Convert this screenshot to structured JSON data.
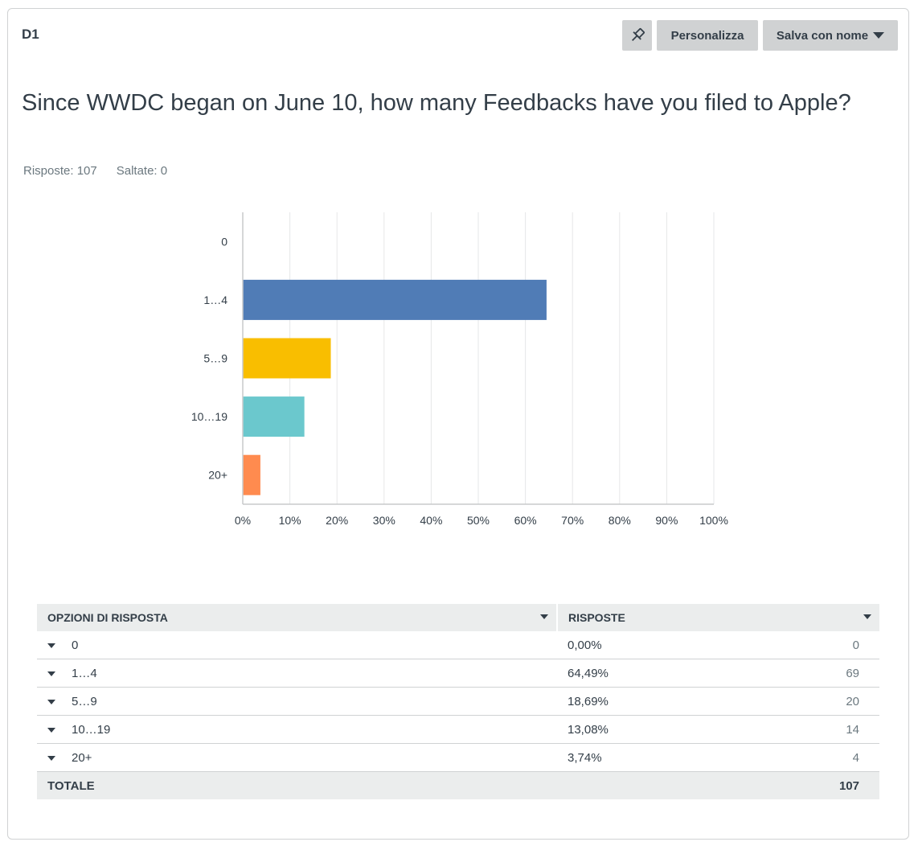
{
  "question": {
    "id": "D1",
    "title": "Since WWDC began on June 10, how many Feedbacks have you filed to Apple?",
    "answered": "Risposte: 107",
    "skipped": "Saltate: 0"
  },
  "toolbar": {
    "pin_icon": "pin-icon",
    "customize_label": "Personalizza",
    "save_label": "Salva con nome"
  },
  "chart_data": {
    "type": "bar",
    "orientation": "horizontal",
    "categories": [
      "0",
      "1...4",
      "5...9",
      "10...19",
      "20+"
    ],
    "values": [
      0.0,
      64.49,
      18.69,
      13.08,
      3.74
    ],
    "colors": [
      "#507cb6",
      "#507cb6",
      "#f9be00",
      "#6bc8cd",
      "#ff8b4f"
    ],
    "xlim": [
      0,
      100
    ],
    "xticks": [
      "0%",
      "10%",
      "20%",
      "30%",
      "40%",
      "50%",
      "60%",
      "70%",
      "80%",
      "90%",
      "100%"
    ],
    "grid": true,
    "title": "",
    "xlabel": "",
    "ylabel": ""
  },
  "table": {
    "headers": [
      "OPZIONI DI RISPOSTA",
      "RISPOSTE"
    ],
    "rows": [
      {
        "option": "0",
        "percent": "0,00%",
        "count": "0"
      },
      {
        "option": "1...4",
        "percent": "64,49%",
        "count": "69"
      },
      {
        "option": "5...9",
        "percent": "18,69%",
        "count": "20"
      },
      {
        "option": "10...19",
        "percent": "13,08%",
        "count": "14"
      },
      {
        "option": "20+",
        "percent": "3,74%",
        "count": "4"
      }
    ],
    "total_label": "TOTALE",
    "total_count": "107"
  }
}
